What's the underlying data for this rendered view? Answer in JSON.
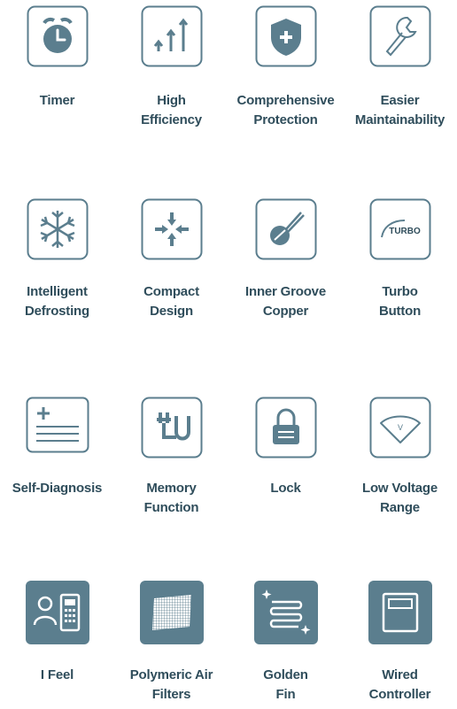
{
  "features": [
    {
      "id": "timer",
      "lines": [
        "Timer"
      ]
    },
    {
      "id": "high-efficiency",
      "lines": [
        "High",
        "Efficiency"
      ]
    },
    {
      "id": "comprehensive-protection",
      "lines": [
        "Comprehensive",
        "Protection"
      ]
    },
    {
      "id": "easier-maintainability",
      "lines": [
        "Easier",
        "Maintainability"
      ]
    },
    {
      "id": "intelligent-defrosting",
      "lines": [
        "Intelligent",
        "Defrosting"
      ]
    },
    {
      "id": "compact-design",
      "lines": [
        "Compact",
        "Design"
      ]
    },
    {
      "id": "inner-groove-copper",
      "lines": [
        "Inner Groove",
        "Copper"
      ]
    },
    {
      "id": "turbo-button",
      "lines": [
        "Turbo",
        "Button"
      ],
      "icon_text": "TURBO"
    },
    {
      "id": "self-diagnosis",
      "lines": [
        "Self-Diagnosis"
      ]
    },
    {
      "id": "memory-function",
      "lines": [
        "Memory",
        "Function"
      ]
    },
    {
      "id": "lock",
      "lines": [
        "Lock"
      ]
    },
    {
      "id": "low-voltage-range",
      "lines": [
        "Low Voltage",
        "Range"
      ],
      "icon_text": "V"
    },
    {
      "id": "i-feel",
      "lines": [
        "I Feel"
      ]
    },
    {
      "id": "polymeric-air-filters",
      "lines": [
        "Polymeric Air",
        "Filters"
      ]
    },
    {
      "id": "golden-fin",
      "lines": [
        "Golden",
        "Fin"
      ]
    },
    {
      "id": "wired-controller",
      "lines": [
        "Wired",
        "Controller"
      ]
    }
  ],
  "colors": {
    "icon": "#5b7e8e",
    "text": "#2f4d5b"
  }
}
